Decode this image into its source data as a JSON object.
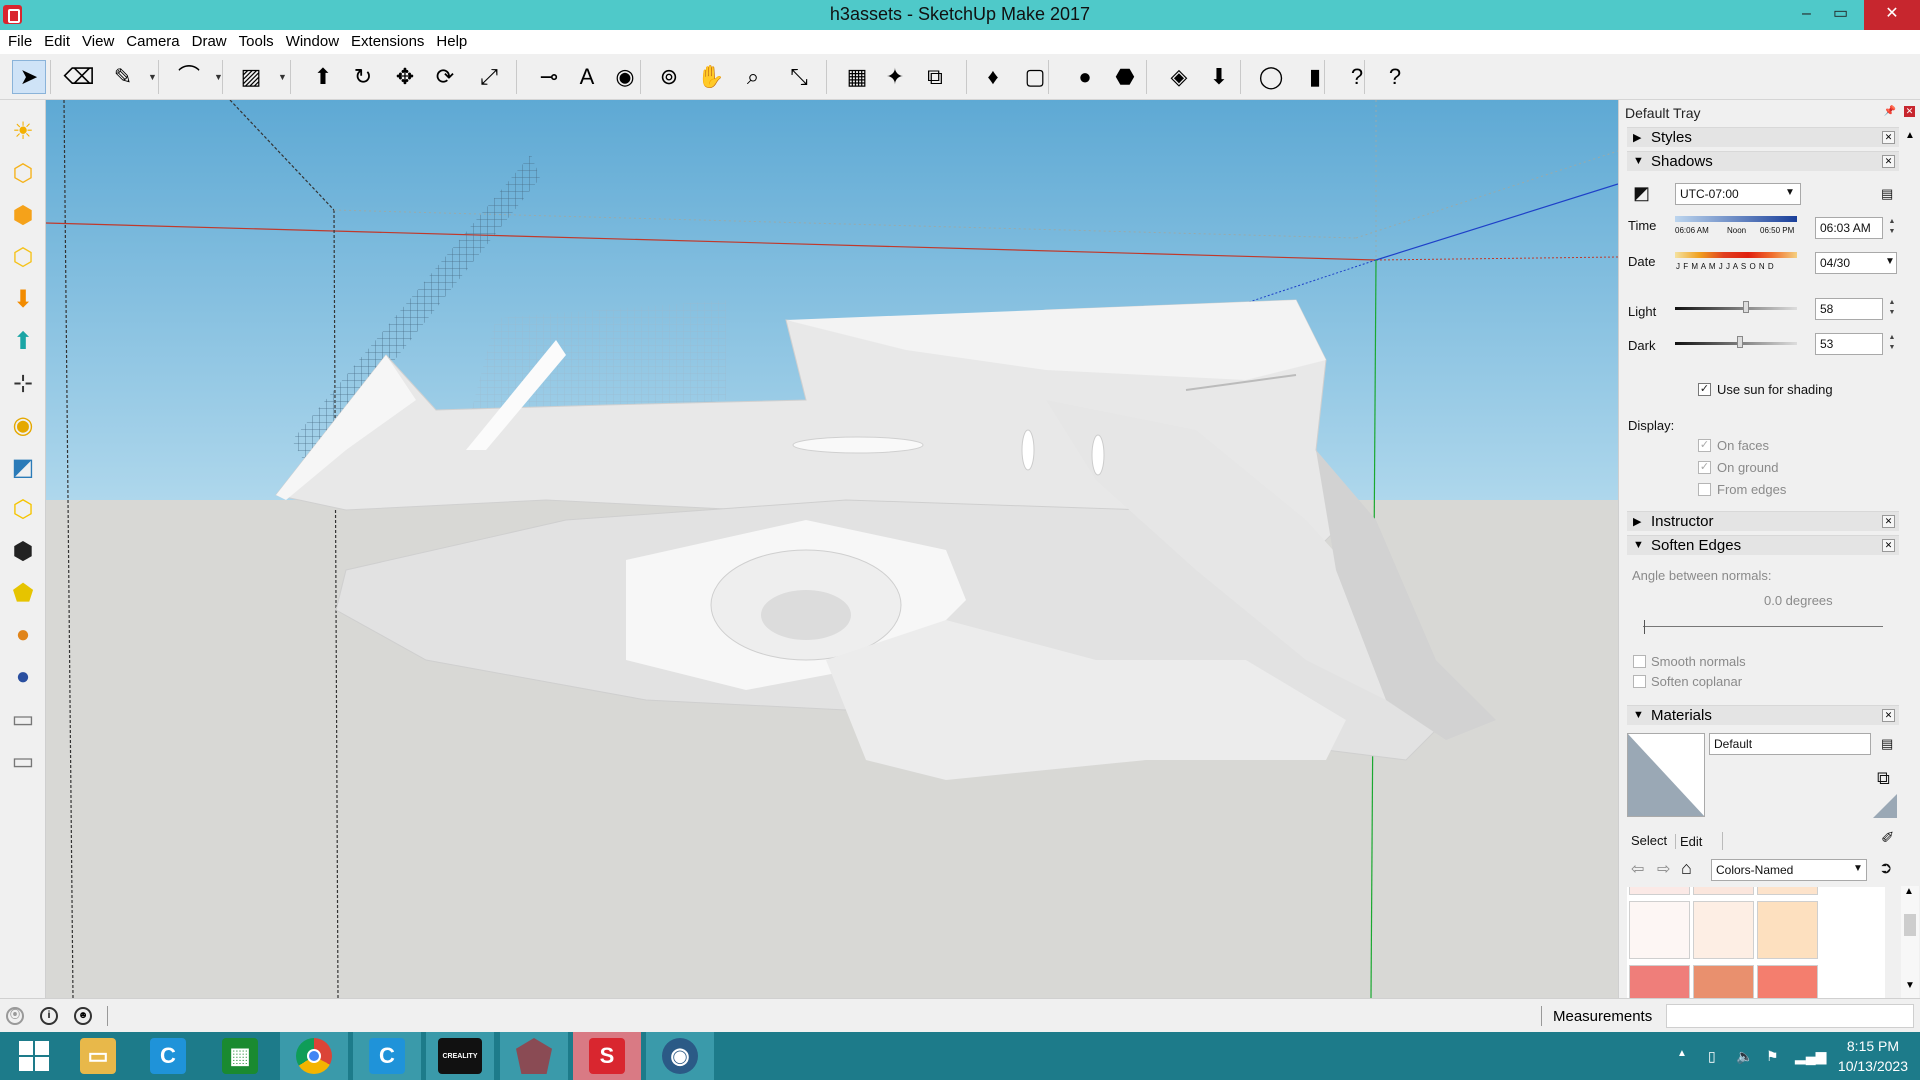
{
  "window": {
    "title": "h3assets - SketchUp Make 2017",
    "minimize": "–",
    "maximize": "▭",
    "close": "✕"
  },
  "menu": [
    "File",
    "Edit",
    "View",
    "Camera",
    "Draw",
    "Tools",
    "Window",
    "Extensions",
    "Help"
  ],
  "toolbar": {
    "icons": [
      "select-icon",
      "eraser-icon",
      "pencil-icon",
      "arc-icon",
      "rectangle-icon",
      "push-pull-icon",
      "follow-me-icon",
      "move-icon",
      "rotate-icon",
      "scale-icon",
      "tape-measure-icon",
      "text-icon",
      "paint-bucket-icon",
      "orbit-icon",
      "pan-icon",
      "zoom-icon",
      "zoom-extents-icon",
      "warehouse-icon",
      "extension-warehouse-icon",
      "layout-icon",
      "ruby-icon",
      "component-icon",
      "add-location-icon",
      "toggle-terrain-icon",
      "sandbox-icon",
      "photo-textures-icon",
      "share-model-icon",
      "preview-icon",
      "instructor-icon",
      "help-icon"
    ],
    "glyphs": [
      "➤",
      "⌫",
      "✎",
      "⌒",
      "▨",
      "⬆",
      "↻",
      "✥",
      "⟳",
      "⤢",
      "⊸",
      "A",
      "◉",
      "⊚",
      "✋",
      "⌕",
      "⤡",
      "▦",
      "✦",
      "⧉",
      "♦",
      "▢",
      "●",
      "⬣",
      "◈",
      "⬇",
      "◯",
      "▮",
      "?",
      "?"
    ]
  },
  "lefttoolbar": {
    "icons": [
      "sun-icon",
      "shape-icon",
      "shape-fill-icon",
      "shape-outline-icon",
      "down-arrow-icon",
      "up-arrow-icon",
      "axes-icon",
      "pin-icon",
      "section-icon",
      "hex-outline-icon",
      "hex-black-icon",
      "shield-icon",
      "orange-orb-icon",
      "blue-orb-icon",
      "eraser-small-icon",
      "eraser-large-icon"
    ],
    "glyphs": [
      "☀",
      "⬡",
      "⬢",
      "⬡",
      "⬇",
      "⬆",
      "⊹",
      "◉",
      "◩",
      "⬡",
      "⬢",
      "⬟",
      "●",
      "●",
      "▭",
      "▭"
    ],
    "colors": [
      "#f3b000",
      "#f5b21a",
      "#f5a21a",
      "#f5c21a",
      "#f28b00",
      "#1aa5a5",
      "#333333",
      "#e5a800",
      "#2b7bb8",
      "#f5c400",
      "#222222",
      "#e6c400",
      "#e0841a",
      "#2a4fa0",
      "#777777",
      "#777777"
    ]
  },
  "tray": {
    "title": "Default Tray",
    "sections": {
      "styles": "Styles",
      "shadows": "Shadows",
      "instructor": "Instructor",
      "soften": "Soften Edges",
      "materials": "Materials"
    },
    "shadows": {
      "timezone": "UTC-07:00",
      "time_label": "Time",
      "time_ticks": [
        "06:06 AM",
        "Noon",
        "06:50 PM"
      ],
      "time_value": "06:03 AM",
      "date_label": "Date",
      "months": "J F M A M J J A S O N D",
      "date_value": "04/30",
      "light_label": "Light",
      "light_value": "58",
      "light_level": 0.58,
      "dark_label": "Dark",
      "dark_value": "53",
      "dark_level": 0.53,
      "use_sun": "Use sun for shading",
      "display_label": "Display:",
      "on_faces": "On faces",
      "on_ground": "On ground",
      "from_edges": "From edges"
    },
    "soften": {
      "angle_label": "Angle between normals:",
      "angle_value": "0.0  degrees",
      "smooth": "Smooth normals",
      "coplanar": "Soften coplanar"
    },
    "materials": {
      "name": "Default",
      "select_tab": "Select",
      "edit_tab": "Edit",
      "library": "Colors-Named",
      "swatches": [
        "#fbe9e6",
        "#fbe6dd",
        "#fde3cb",
        "#fdf6f4",
        "#fdeee4",
        "#fde0bf",
        "#ef7e7a",
        "#e9906e",
        "#f47e6e"
      ]
    }
  },
  "status": {
    "measurements": "Measurements"
  },
  "taskbar": {
    "apps": [
      "start-button",
      "file-explorer",
      "cura-app",
      "calculator-app",
      "chrome-app",
      "cura-app-2",
      "creality-app",
      "solid-app",
      "sketchup-app",
      "blender-app"
    ],
    "creality": "CREALITY",
    "time": "8:15 PM",
    "date": "10/13/2023"
  },
  "colors": {
    "titlebar": "#4fc9c9",
    "sky_top": "#5ea9d4",
    "sky_bottom": "#a9d4ea",
    "ground": "#d8d8d5",
    "taskbar": "#1d7b8a"
  }
}
